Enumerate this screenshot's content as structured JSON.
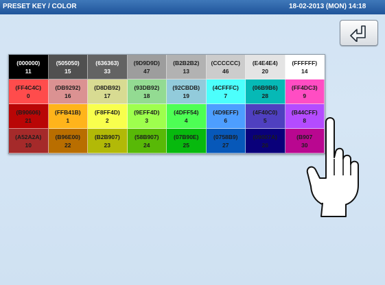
{
  "header": {
    "title": "PRESET KEY / COLOR",
    "datetime": "18-02-2013 (MON) 14:18"
  },
  "back_button": {
    "icon": "return-arrow-icon"
  },
  "color_grid": [
    {
      "code": "(000000)",
      "number": "11",
      "hex": "#000000",
      "text": "dark"
    },
    {
      "code": "(505050)",
      "number": "15",
      "hex": "#505050",
      "text": "dark"
    },
    {
      "code": "(636363)",
      "number": "33",
      "hex": "#636363",
      "text": "dark"
    },
    {
      "code": "(9D9D9D)",
      "number": "47",
      "hex": "#9D9D9D",
      "text": "light"
    },
    {
      "code": "(B2B2B2)",
      "number": "13",
      "hex": "#B2B2B2",
      "text": "light"
    },
    {
      "code": "(CCCCCC)",
      "number": "46",
      "hex": "#CCCCCC",
      "text": "light"
    },
    {
      "code": "(E4E4E4)",
      "number": "20",
      "hex": "#E4E4E4",
      "text": "light"
    },
    {
      "code": "(FFFFFF)",
      "number": "14",
      "hex": "#FFFFFF",
      "text": "light"
    },
    {
      "code": "(FF4C4C)",
      "number": "0",
      "hex": "#FF4C4C",
      "text": "light"
    },
    {
      "code": "(DB9292)",
      "number": "16",
      "hex": "#DB9292",
      "text": "light"
    },
    {
      "code": "(D8DB92)",
      "number": "17",
      "hex": "#D8DB92",
      "text": "light"
    },
    {
      "code": "(93DB92)",
      "number": "18",
      "hex": "#93DB92",
      "text": "light"
    },
    {
      "code": "(92CBDB)",
      "number": "19",
      "hex": "#92CBDB",
      "text": "light"
    },
    {
      "code": "(4CFFFC)",
      "number": "7",
      "hex": "#4CFFFC",
      "text": "light"
    },
    {
      "code": "(06B9B6)",
      "number": "28",
      "hex": "#06B9B6",
      "text": "light"
    },
    {
      "code": "(FF4DC3)",
      "number": "9",
      "hex": "#FF4DC3",
      "text": "light"
    },
    {
      "code": "(B90606)",
      "number": "21",
      "hex": "#B90606",
      "text": "light"
    },
    {
      "code": "(FFB41B)",
      "number": "1",
      "hex": "#FFB41B",
      "text": "light"
    },
    {
      "code": "(F8FF4D)",
      "number": "2",
      "hex": "#F8FF4D",
      "text": "light"
    },
    {
      "code": "(9EFF4D)",
      "number": "3",
      "hex": "#9EFF4D",
      "text": "light"
    },
    {
      "code": "(4DFF54)",
      "number": "4",
      "hex": "#4DFF54",
      "text": "light"
    },
    {
      "code": "(4D9EFF)",
      "number": "6",
      "hex": "#4D9EFF",
      "text": "light"
    },
    {
      "code": "(4F40C0)",
      "number": "5",
      "hex": "#4F40C0",
      "text": "light"
    },
    {
      "code": "(B44CFF)",
      "number": "8",
      "hex": "#B44CFF",
      "text": "light"
    },
    {
      "code": "(A52A2A)",
      "number": "10",
      "hex": "#A52A2A",
      "text": "light"
    },
    {
      "code": "(B96E00)",
      "number": "22",
      "hex": "#B96E00",
      "text": "light"
    },
    {
      "code": "(B2B907)",
      "number": "23",
      "hex": "#B2B907",
      "text": "light"
    },
    {
      "code": "(58B907)",
      "number": "24",
      "hex": "#58B907",
      "text": "light"
    },
    {
      "code": "(07B90E)",
      "number": "25",
      "hex": "#07B90E",
      "text": "light"
    },
    {
      "code": "(0758B9)",
      "number": "27",
      "hex": "#0758B9",
      "text": "light"
    },
    {
      "code": "(09007A)",
      "number": "26",
      "hex": "#09007A",
      "text": "light"
    },
    {
      "code": "(B907",
      "number": "30",
      "hex": "#B90790",
      "text": "light"
    }
  ],
  "hand_icon": "pointing-hand-icon"
}
